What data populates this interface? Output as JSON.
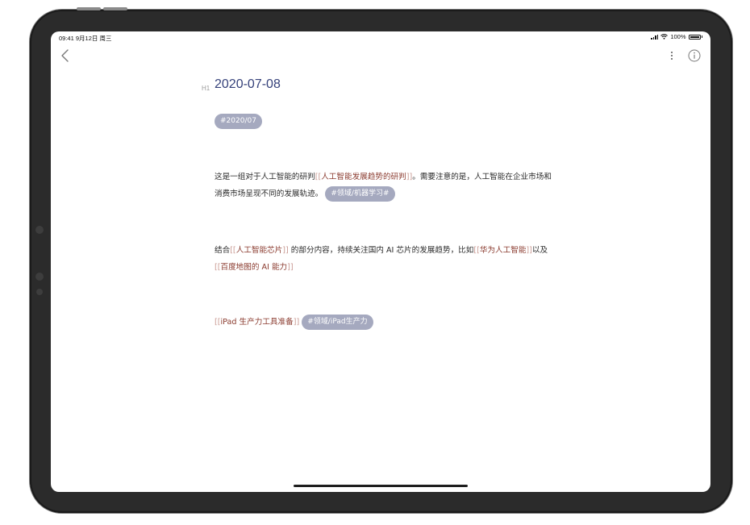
{
  "status_bar": {
    "time_date": "09:41  9月12日 周三",
    "battery": "100%"
  },
  "toolbar": {
    "back_icon": "chevron-left-icon",
    "more_icon": "vertical-ellipsis-icon",
    "info_icon": "info-circle-icon"
  },
  "document": {
    "heading_marker": "H1",
    "title": "2020-07-08",
    "date_tag": "#2020/07",
    "paragraph1": {
      "text_before": "这是一组对于人工智能的研判",
      "link_open": "[[",
      "link": "人工智能发展趋势的研判",
      "link_close": "]]",
      "text_after": "。需要注意的是，人工智能在企业市场和消费市场呈现不同的发展轨迹。",
      "tag": "#领域/机器学习#"
    },
    "paragraph2": {
      "text_start": "结合",
      "link1_open": "[[",
      "link1": "人工智能芯片",
      "link1_close": "]]",
      "text_middle": " 的部分内容，持续关注国内 AI 芯片的发展趋势，比如",
      "link2_open": "[[",
      "link2": "华为人工智能",
      "link2_close": "]]",
      "text_joiner": "以及",
      "link3_open": "[[",
      "link3": "百度地图的 AI 能力",
      "link3_close": "]]"
    },
    "paragraph3": {
      "link_open": "[[",
      "link": "iPad 生产力工具准备",
      "link_close": "]]",
      "tag": "#领域/iPad生产力"
    }
  },
  "colors": {
    "heading": "#35417a",
    "wikilink": "#8a3a2e",
    "tag_bg": "#a5a9bf",
    "bezel": "#2b2b2b"
  }
}
